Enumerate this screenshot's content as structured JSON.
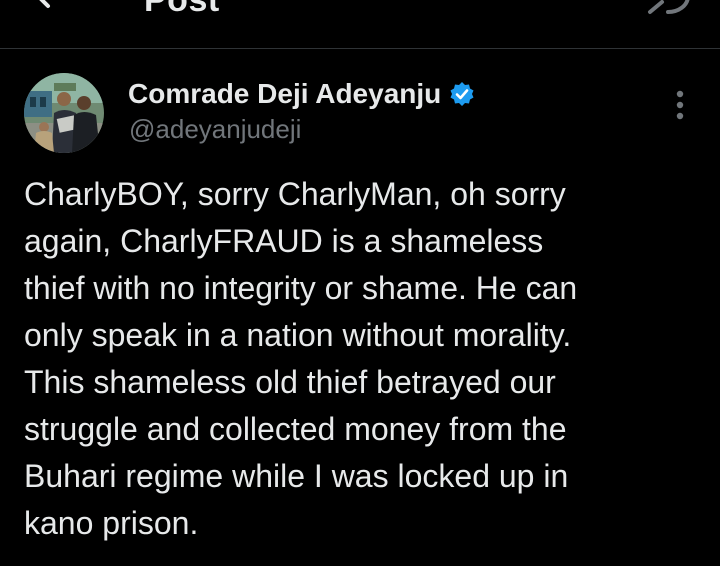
{
  "header": {
    "title": "Post",
    "back_icon": "arrow-left-icon",
    "reply_icon": "reply-icon"
  },
  "post": {
    "author": {
      "name": "Comrade Deji Adeyanju",
      "handle": "@adeyanjudeji",
      "verified": true,
      "verified_color": "#1d9bf0",
      "avatar_icon": "profile-photo"
    },
    "menu_icon": "more-vertical-icon",
    "text_lines": [
      "CharlyBOY, sorry CharlyMan, oh sorry",
      "again, CharlyFRAUD is a shameless",
      "thief with no integrity or shame. He can",
      "only speak in a nation without morality.",
      "This shameless old thief betrayed our",
      "struggle and collected money from the",
      "Buhari regime while I was locked up in",
      "kano prison."
    ]
  },
  "colors": {
    "background": "#000000",
    "text_primary": "#e7e9ea",
    "text_secondary": "#71767b",
    "divider": "#2f3336",
    "accent": "#1d9bf0"
  }
}
